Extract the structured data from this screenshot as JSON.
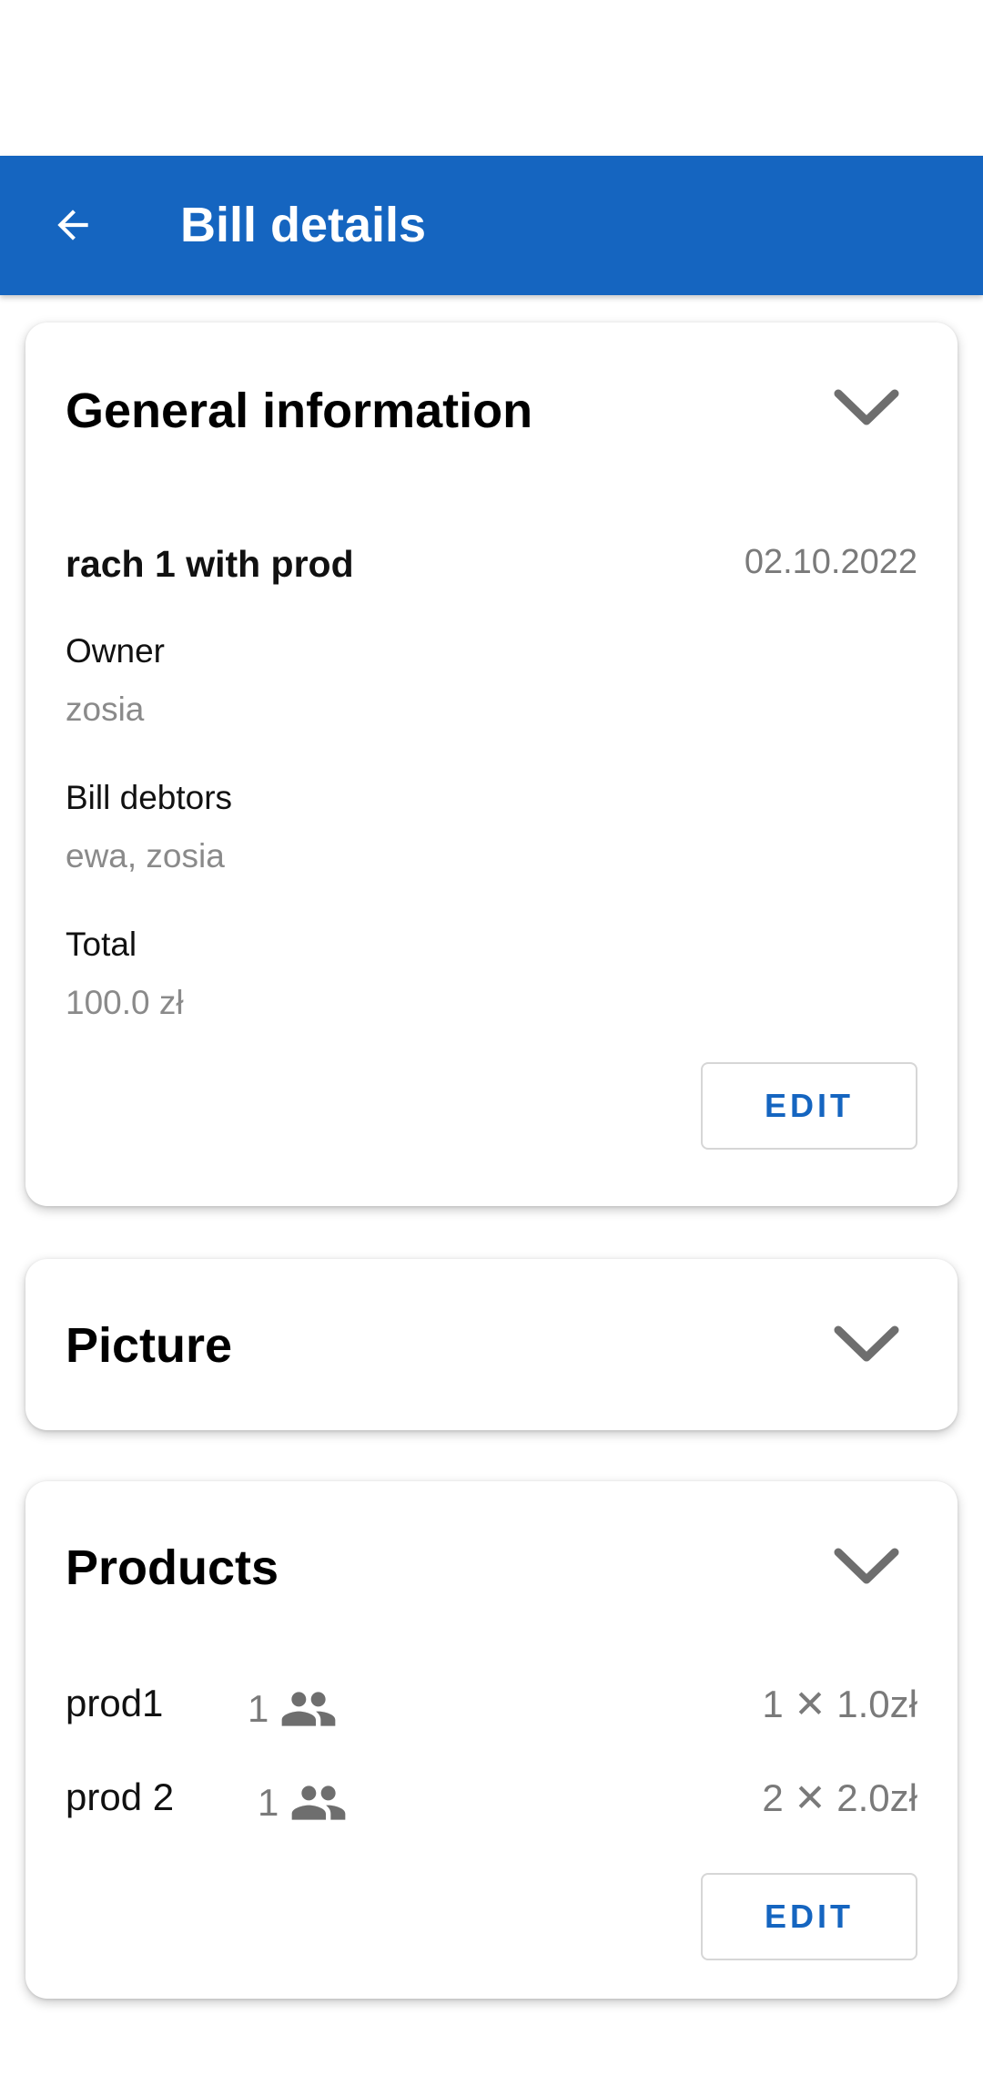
{
  "app_bar": {
    "title": "Bill details",
    "back_icon": "arrow-back-icon"
  },
  "colors": {
    "primary": "#1565c0",
    "secondary_text": "#7a7a7a"
  },
  "general_info": {
    "title": "General information",
    "bill_name": "rach 1 with prod",
    "date": "02.10.2022",
    "owner_label": "Owner",
    "owner_value": "zosia",
    "debtors_label": "Bill debtors",
    "debtors_value": "ewa, zosia",
    "total_label": "Total",
    "total_value": "100.0 zł",
    "edit_label": "EDIT"
  },
  "picture": {
    "title": "Picture"
  },
  "products": {
    "title": "Products",
    "items": [
      {
        "name": "prod1",
        "people": "1",
        "price": "1 ✕ 1.0zł"
      },
      {
        "name": "prod 2",
        "people": "1",
        "price": "2 ✕ 2.0zł"
      }
    ],
    "edit_label": "EDIT"
  }
}
